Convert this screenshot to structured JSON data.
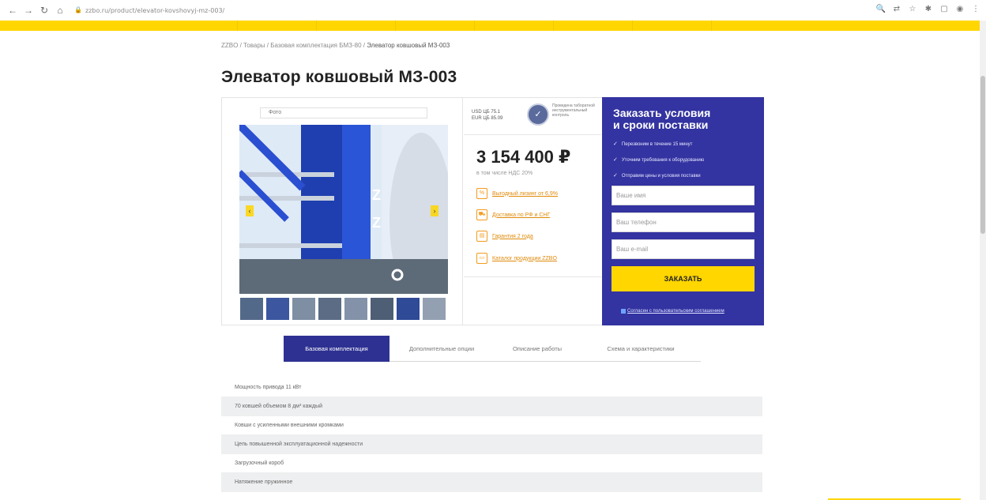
{
  "browser": {
    "url": "zzbo.ru/product/elevator-kovshovyj-mz-003/"
  },
  "breadcrumb": {
    "items": [
      "ZZBO",
      "Товары",
      "Базовая комплектация БМЗ-80"
    ],
    "current": "Элеватор ковшовый МЗ-003"
  },
  "page": {
    "title": "Элеватор ковшовый МЗ-003"
  },
  "gallery": {
    "tab_label": "Фото",
    "thumbnail_count": 8
  },
  "price_block": {
    "rates": [
      "USD ЦБ 75.1",
      "EUR ЦБ 85.09"
    ],
    "badge_text": "Проведена таборатной инструментальный контроль",
    "price": "3 154 400 ₽",
    "vat_note": "в том числе НДС 20%",
    "perks": [
      {
        "label": "Выгодный лизинг от 6,9%",
        "icon": "leasing-icon"
      },
      {
        "label": "Доставка по РФ и СНГ",
        "icon": "truck-icon"
      },
      {
        "label": "Гарантия 2 года",
        "icon": "guarantee-icon"
      },
      {
        "label": "Каталог продукции ZZBO",
        "icon": "catalog-icon"
      }
    ]
  },
  "order_form": {
    "title_line1": "Заказать условия",
    "title_line2": "и сроки поставки",
    "checks": [
      "Перезвоним в течение 15 минут",
      "Уточним требования к оборудованию",
      "Отправим цены и условия поставки"
    ],
    "name_placeholder": "Ваше имя",
    "phone_placeholder": "Ваш телефон",
    "email_placeholder": "Ваш e-mail",
    "submit_label": "ЗАКАЗАТЬ",
    "consent_label": "Согласен с пользовательским соглашением"
  },
  "tabs": [
    {
      "label": "Базовая комплектация",
      "active": true
    },
    {
      "label": "Дополнительные опции",
      "active": false
    },
    {
      "label": "Описание работы",
      "active": false
    },
    {
      "label": "Схема и характеристики",
      "active": false
    }
  ],
  "specs": [
    "Мощность привода 11 кВт",
    "70 ковшей объемом 8 дм³ каждый",
    "Ковши с усиленными внешними кромками",
    "Цепь повышенной эксплуатационной надежности",
    "Загрузочный короб",
    "Натяжение пружинное"
  ],
  "colors": {
    "brand_yellow": "#ffd600",
    "brand_blue": "#3333a1",
    "accent_orange": "#e08a0a"
  }
}
